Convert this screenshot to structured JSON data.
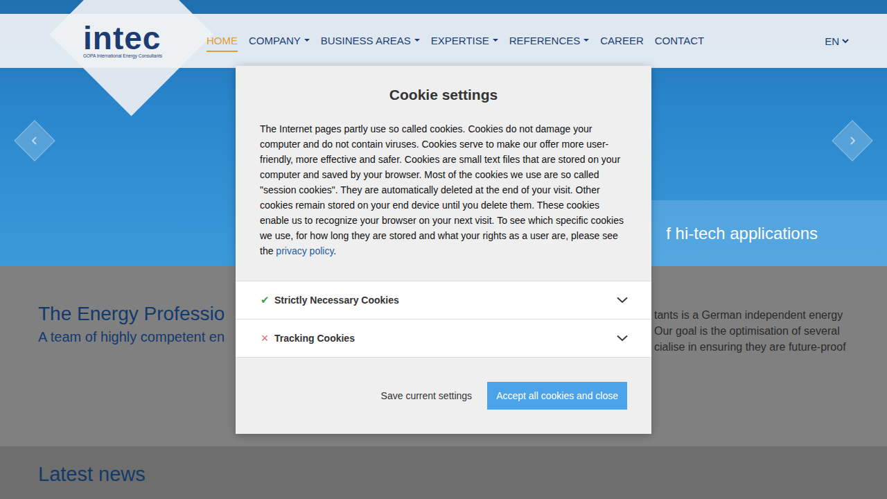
{
  "logo": {
    "name": "intec",
    "tagline": "GOPA International Energy Consultants"
  },
  "nav": [
    {
      "label": "HOME",
      "selected": true,
      "has_menu": false
    },
    {
      "label": "COMPANY",
      "selected": false,
      "has_menu": true
    },
    {
      "label": "BUSINESS AREAS",
      "selected": false,
      "has_menu": true
    },
    {
      "label": "EXPERTISE",
      "selected": false,
      "has_menu": true
    },
    {
      "label": "REFERENCES",
      "selected": false,
      "has_menu": true
    },
    {
      "label": "CAREER",
      "selected": false,
      "has_menu": false
    },
    {
      "label": "CONTACT",
      "selected": false,
      "has_menu": false
    }
  ],
  "language": {
    "label": "EN"
  },
  "hero": {
    "caption": "f hi-tech applications"
  },
  "intro": {
    "title": "The Energy Professio",
    "subtitle": "A team of highly competent en",
    "lines": [
      "tants is a German independent energy",
      "Our goal is the optimisation of several",
      "cialise in ensuring they are future-proof"
    ]
  },
  "news": {
    "title": "Latest news"
  },
  "cookie_dialog": {
    "title": "Cookie settings",
    "text": "The Internet pages partly use so called cookies. Cookies do not damage your computer and do not contain viruses. Cookies serve to make our offer more user-friendly, more effective and safer. Cookies are small text files that are stored on your computer and saved by your browser. Most of the cookies we use are so called \"session cookies\". They are automatically deleted at the end of your visit. Other cookies remain stored on your end device until you delete them. These cookies enable us to recognize your browser on your next visit. To see which specific cookies we use, for how long they are stored and what your rights as a user are, please see the ",
    "link": "privacy policy",
    "text_end": ".",
    "categories": [
      {
        "label": "Strictly Necessary Cookies",
        "icon": "✔",
        "enabled": true,
        "expanded": false
      },
      {
        "label": "Tracking Cookies",
        "icon": "×",
        "enabled": false,
        "expanded": false
      }
    ],
    "buttons": [
      {
        "label": "Save current settings",
        "kind": "secondary"
      },
      {
        "label": "Accept all cookies and close",
        "kind": "primary"
      }
    ]
  }
}
